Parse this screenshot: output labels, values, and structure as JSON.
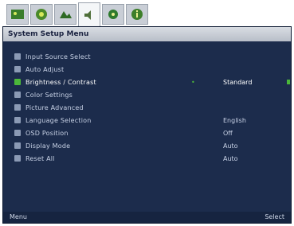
{
  "tabs": [
    {
      "icon": "picture-icon"
    },
    {
      "icon": "color-icon"
    },
    {
      "icon": "image-icon"
    },
    {
      "icon": "audio-icon"
    },
    {
      "icon": "settings-icon"
    },
    {
      "icon": "info-icon"
    }
  ],
  "header": {
    "title": "System Setup Menu"
  },
  "items": [
    {
      "label": "Input Source Select",
      "value": ""
    },
    {
      "label": "Auto Adjust",
      "value": ""
    },
    {
      "label": "Brightness / Contrast",
      "value": "Standard",
      "selected": true
    },
    {
      "label": "Color Settings",
      "value": ""
    },
    {
      "label": "Picture Advanced",
      "value": ""
    },
    {
      "label": "Language Selection",
      "value": "English"
    },
    {
      "label": "OSD Position",
      "value": "Off"
    },
    {
      "label": "Display Mode",
      "value": "Auto"
    },
    {
      "label": "Reset All",
      "value": "Auto"
    }
  ],
  "footer": {
    "left": "Menu",
    "right": "Select"
  }
}
